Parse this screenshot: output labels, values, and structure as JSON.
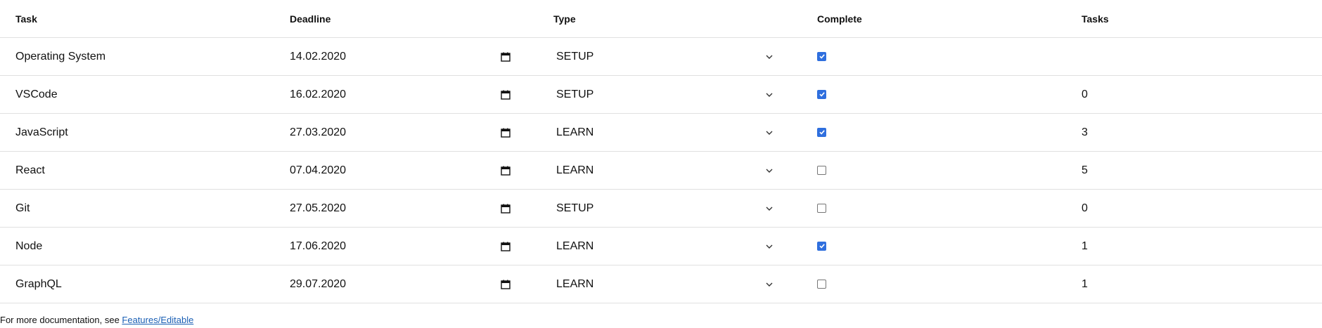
{
  "header": {
    "task": "Task",
    "deadline": "Deadline",
    "type": "Type",
    "complete": "Complete",
    "tasks": "Tasks"
  },
  "rows": [
    {
      "task": "Operating System",
      "deadline": "14.02.2020",
      "type": "SETUP",
      "complete": true,
      "tasks": ""
    },
    {
      "task": "VSCode",
      "deadline": "16.02.2020",
      "type": "SETUP",
      "complete": true,
      "tasks": "0"
    },
    {
      "task": "JavaScript",
      "deadline": "27.03.2020",
      "type": "LEARN",
      "complete": true,
      "tasks": "3"
    },
    {
      "task": "React",
      "deadline": "07.04.2020",
      "type": "LEARN",
      "complete": false,
      "tasks": "5"
    },
    {
      "task": "Git",
      "deadline": "27.05.2020",
      "type": "SETUP",
      "complete": false,
      "tasks": "0"
    },
    {
      "task": "Node",
      "deadline": "17.06.2020",
      "type": "LEARN",
      "complete": true,
      "tasks": "1"
    },
    {
      "task": "GraphQL",
      "deadline": "29.07.2020",
      "type": "LEARN",
      "complete": false,
      "tasks": "1"
    }
  ],
  "footer": {
    "text": "For more documentation, see ",
    "link_label": "Features/Editable"
  },
  "icons": {
    "deadline": "calendar-icon",
    "type": "chevron-down-icon"
  },
  "colors": {
    "checkbox_checked": "#2f6fde",
    "link": "#1a5fb4",
    "divider": "#e0e0e0"
  }
}
